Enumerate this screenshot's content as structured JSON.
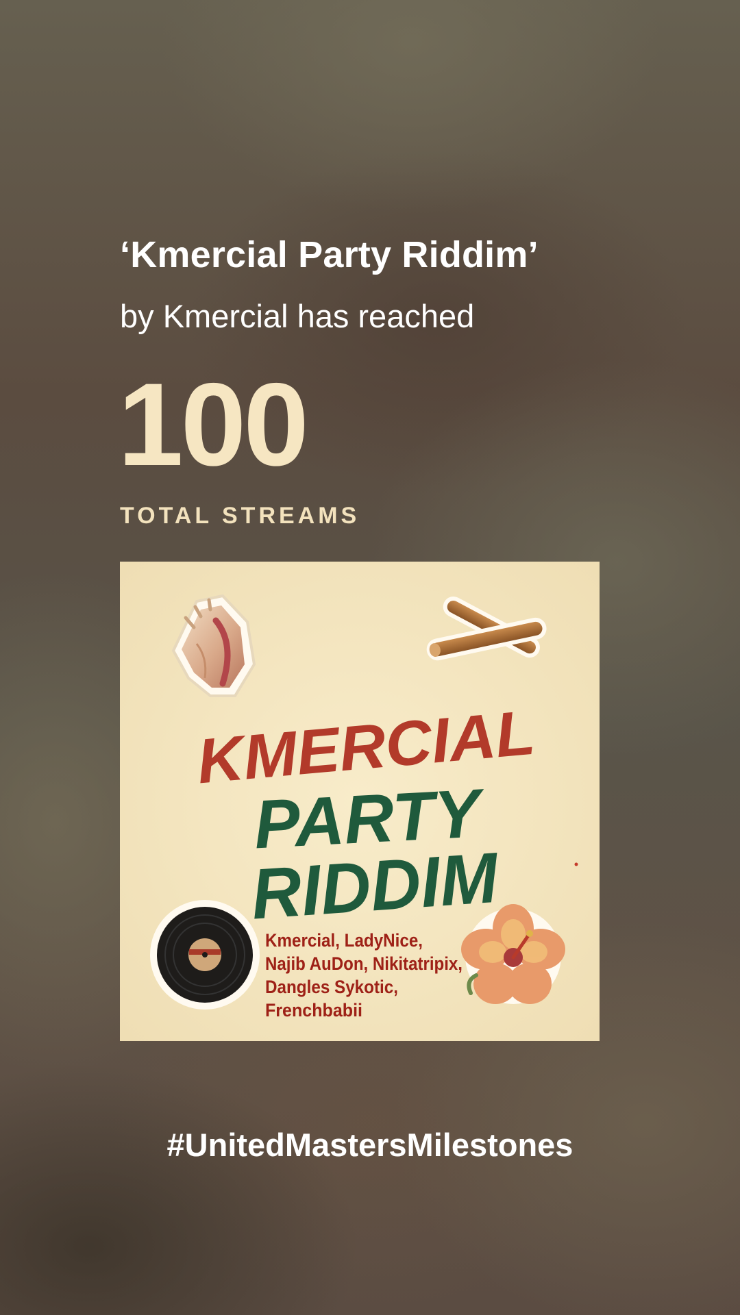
{
  "milestone": {
    "title": "‘Kmercial Party Riddim’",
    "subtitle": "by Kmercial has reached",
    "count": "100",
    "count_label": "TOTAL STREAMS"
  },
  "cover_art": {
    "title_lines": [
      "KMERCIAL",
      "PARTY",
      "RIDDIM"
    ],
    "artist_lines": [
      "Kmercial, LadyNice,",
      "Najib AuDon, Nikitatripix,",
      "Dangles Sykotic,",
      "Frenchbabii"
    ],
    "icons": [
      "conch-shell-icon",
      "drumsticks-icon",
      "vinyl-record-icon",
      "hibiscus-flower-icon"
    ],
    "colors": {
      "background": "#f5e8c4",
      "title_red": "#b23a2a",
      "title_green": "#1f5a3c",
      "artist_text": "#9e2117"
    }
  },
  "hashtag": "#UnitedMastersMilestones",
  "colors": {
    "accent": "#f6e6c2",
    "text": "#ffffff"
  }
}
